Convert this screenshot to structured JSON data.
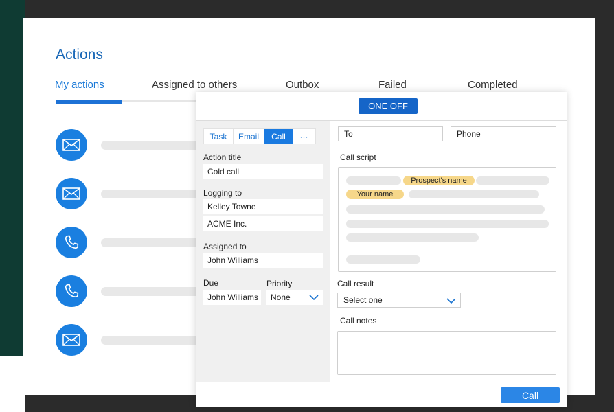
{
  "page": {
    "title": "Actions"
  },
  "tabs": [
    {
      "label": "My actions"
    },
    {
      "label": "Assigned to others"
    },
    {
      "label": "Outbox"
    },
    {
      "label": "Failed"
    },
    {
      "label": "Completed"
    }
  ],
  "list": [
    {
      "icon": "envelope-icon"
    },
    {
      "icon": "envelope-icon"
    },
    {
      "icon": "phone-icon"
    },
    {
      "icon": "phone-icon"
    },
    {
      "icon": "envelope-icon"
    }
  ],
  "modal": {
    "one_off": "ONE OFF",
    "types": [
      "Task",
      "Email",
      "Call",
      "···"
    ],
    "selected_type": "Call",
    "action_title": {
      "label": "Action title",
      "value": "Cold call"
    },
    "logging_to": {
      "label": "Logging to",
      "contact": "Kelley Towne",
      "company": "ACME Inc."
    },
    "assigned_to": {
      "label": "Assigned to",
      "value": "John Williams"
    },
    "due": {
      "label": "Due",
      "value": "John Williams"
    },
    "priority": {
      "label": "Priority",
      "value": "None"
    },
    "to_placeholder": "To",
    "phone_placeholder": "Phone",
    "call_script": {
      "label": "Call script",
      "prospect_tag": "Prospect's name",
      "your_tag": "Your name"
    },
    "call_result": {
      "label": "Call result",
      "value": "Select one"
    },
    "call_notes": {
      "label": "Call notes",
      "value": ""
    },
    "call_button": "Call"
  },
  "colors": {
    "primary": "#1a7fe0",
    "accent_tag": "#f6d78a",
    "title": "#1565b6"
  }
}
